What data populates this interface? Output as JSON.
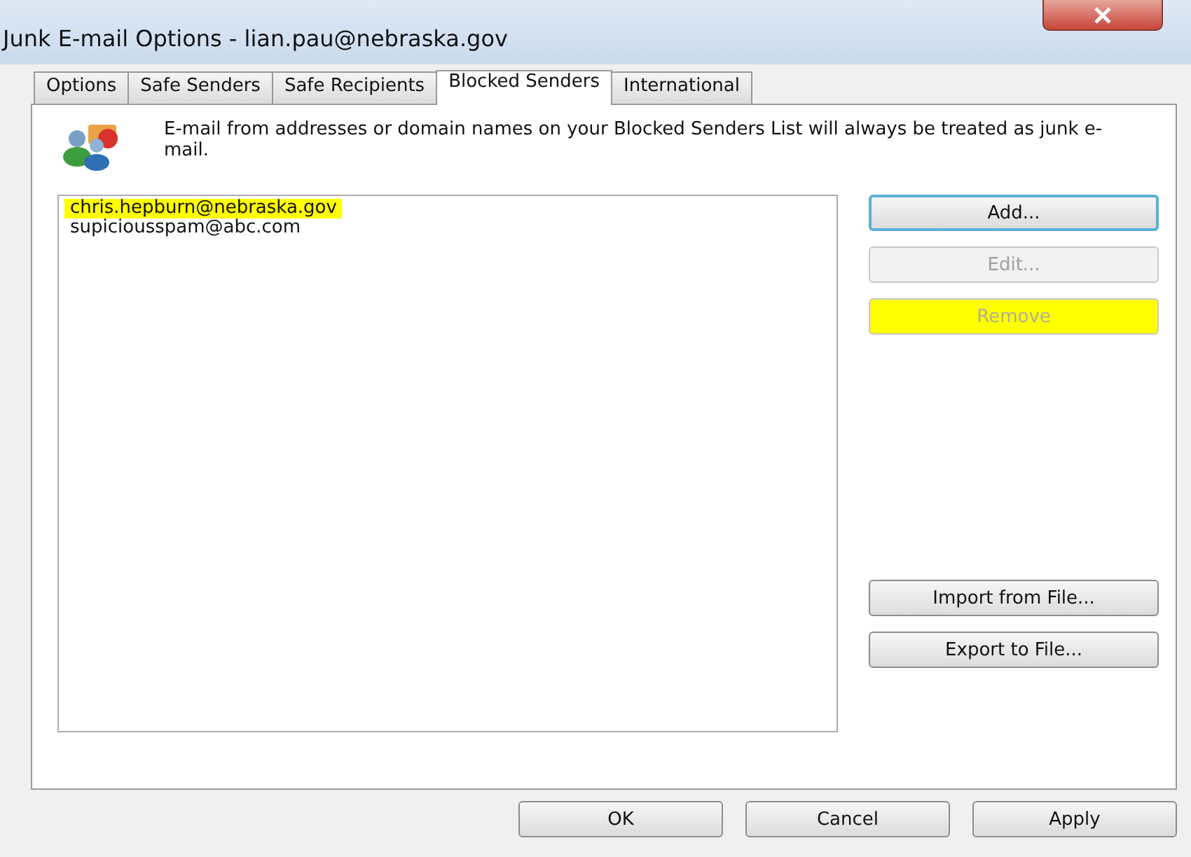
{
  "window": {
    "title": "Junk E-mail Options - lian.pau@nebraska.gov"
  },
  "tabs": [
    {
      "label": "Options",
      "selected": false
    },
    {
      "label": "Safe Senders",
      "selected": false
    },
    {
      "label": "Safe Recipients",
      "selected": false
    },
    {
      "label": "Blocked Senders",
      "selected": true
    },
    {
      "label": "International",
      "selected": false
    }
  ],
  "description": "E-mail from addresses or domain names on your Blocked Senders List will always be treated as junk e-mail.",
  "blocked_list": [
    {
      "address": "chris.hepburn@nebraska.gov",
      "highlighted": true
    },
    {
      "address": "supiciousspam@abc.com",
      "highlighted": false
    }
  ],
  "side_buttons": [
    {
      "label": "Add...",
      "disabled": false,
      "default": true,
      "highlighted": false
    },
    {
      "label": "Edit...",
      "disabled": true,
      "default": false,
      "highlighted": false
    },
    {
      "label": "Remove",
      "disabled": true,
      "default": false,
      "highlighted": true
    }
  ],
  "file_buttons": [
    "Import from File...",
    "Export to File..."
  ],
  "dialog_buttons": [
    "OK",
    "Cancel",
    "Apply"
  ]
}
